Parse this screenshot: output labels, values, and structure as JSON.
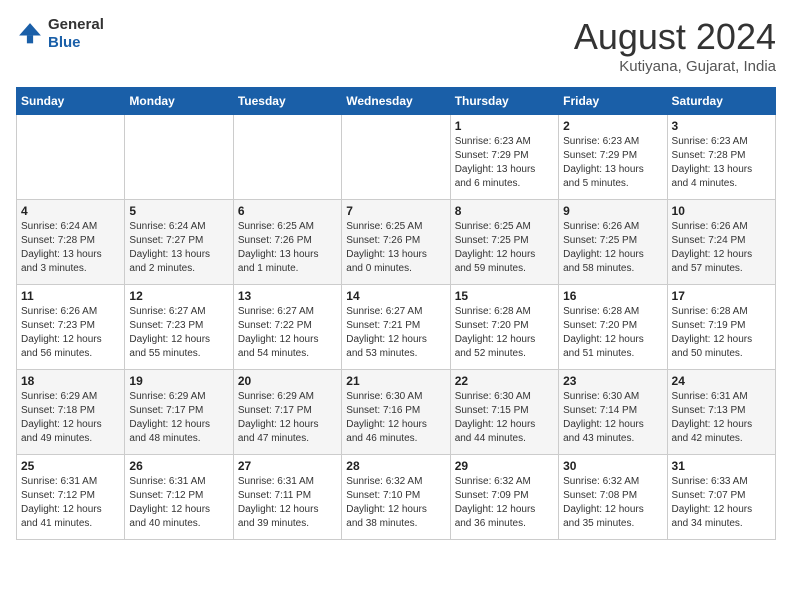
{
  "header": {
    "logo_line1": "General",
    "logo_line2": "Blue",
    "month_year": "August 2024",
    "location": "Kutiyana, Gujarat, India"
  },
  "weekdays": [
    "Sunday",
    "Monday",
    "Tuesday",
    "Wednesday",
    "Thursday",
    "Friday",
    "Saturday"
  ],
  "weeks": [
    [
      {
        "day": "",
        "info": ""
      },
      {
        "day": "",
        "info": ""
      },
      {
        "day": "",
        "info": ""
      },
      {
        "day": "",
        "info": ""
      },
      {
        "day": "1",
        "info": "Sunrise: 6:23 AM\nSunset: 7:29 PM\nDaylight: 13 hours and 6 minutes."
      },
      {
        "day": "2",
        "info": "Sunrise: 6:23 AM\nSunset: 7:29 PM\nDaylight: 13 hours and 5 minutes."
      },
      {
        "day": "3",
        "info": "Sunrise: 6:23 AM\nSunset: 7:28 PM\nDaylight: 13 hours and 4 minutes."
      }
    ],
    [
      {
        "day": "4",
        "info": "Sunrise: 6:24 AM\nSunset: 7:28 PM\nDaylight: 13 hours and 3 minutes."
      },
      {
        "day": "5",
        "info": "Sunrise: 6:24 AM\nSunset: 7:27 PM\nDaylight: 13 hours and 2 minutes."
      },
      {
        "day": "6",
        "info": "Sunrise: 6:25 AM\nSunset: 7:26 PM\nDaylight: 13 hours and 1 minute."
      },
      {
        "day": "7",
        "info": "Sunrise: 6:25 AM\nSunset: 7:26 PM\nDaylight: 13 hours and 0 minutes."
      },
      {
        "day": "8",
        "info": "Sunrise: 6:25 AM\nSunset: 7:25 PM\nDaylight: 12 hours and 59 minutes."
      },
      {
        "day": "9",
        "info": "Sunrise: 6:26 AM\nSunset: 7:25 PM\nDaylight: 12 hours and 58 minutes."
      },
      {
        "day": "10",
        "info": "Sunrise: 6:26 AM\nSunset: 7:24 PM\nDaylight: 12 hours and 57 minutes."
      }
    ],
    [
      {
        "day": "11",
        "info": "Sunrise: 6:26 AM\nSunset: 7:23 PM\nDaylight: 12 hours and 56 minutes."
      },
      {
        "day": "12",
        "info": "Sunrise: 6:27 AM\nSunset: 7:23 PM\nDaylight: 12 hours and 55 minutes."
      },
      {
        "day": "13",
        "info": "Sunrise: 6:27 AM\nSunset: 7:22 PM\nDaylight: 12 hours and 54 minutes."
      },
      {
        "day": "14",
        "info": "Sunrise: 6:27 AM\nSunset: 7:21 PM\nDaylight: 12 hours and 53 minutes."
      },
      {
        "day": "15",
        "info": "Sunrise: 6:28 AM\nSunset: 7:20 PM\nDaylight: 12 hours and 52 minutes."
      },
      {
        "day": "16",
        "info": "Sunrise: 6:28 AM\nSunset: 7:20 PM\nDaylight: 12 hours and 51 minutes."
      },
      {
        "day": "17",
        "info": "Sunrise: 6:28 AM\nSunset: 7:19 PM\nDaylight: 12 hours and 50 minutes."
      }
    ],
    [
      {
        "day": "18",
        "info": "Sunrise: 6:29 AM\nSunset: 7:18 PM\nDaylight: 12 hours and 49 minutes."
      },
      {
        "day": "19",
        "info": "Sunrise: 6:29 AM\nSunset: 7:17 PM\nDaylight: 12 hours and 48 minutes."
      },
      {
        "day": "20",
        "info": "Sunrise: 6:29 AM\nSunset: 7:17 PM\nDaylight: 12 hours and 47 minutes."
      },
      {
        "day": "21",
        "info": "Sunrise: 6:30 AM\nSunset: 7:16 PM\nDaylight: 12 hours and 46 minutes."
      },
      {
        "day": "22",
        "info": "Sunrise: 6:30 AM\nSunset: 7:15 PM\nDaylight: 12 hours and 44 minutes."
      },
      {
        "day": "23",
        "info": "Sunrise: 6:30 AM\nSunset: 7:14 PM\nDaylight: 12 hours and 43 minutes."
      },
      {
        "day": "24",
        "info": "Sunrise: 6:31 AM\nSunset: 7:13 PM\nDaylight: 12 hours and 42 minutes."
      }
    ],
    [
      {
        "day": "25",
        "info": "Sunrise: 6:31 AM\nSunset: 7:12 PM\nDaylight: 12 hours and 41 minutes."
      },
      {
        "day": "26",
        "info": "Sunrise: 6:31 AM\nSunset: 7:12 PM\nDaylight: 12 hours and 40 minutes."
      },
      {
        "day": "27",
        "info": "Sunrise: 6:31 AM\nSunset: 7:11 PM\nDaylight: 12 hours and 39 minutes."
      },
      {
        "day": "28",
        "info": "Sunrise: 6:32 AM\nSunset: 7:10 PM\nDaylight: 12 hours and 38 minutes."
      },
      {
        "day": "29",
        "info": "Sunrise: 6:32 AM\nSunset: 7:09 PM\nDaylight: 12 hours and 36 minutes."
      },
      {
        "day": "30",
        "info": "Sunrise: 6:32 AM\nSunset: 7:08 PM\nDaylight: 12 hours and 35 minutes."
      },
      {
        "day": "31",
        "info": "Sunrise: 6:33 AM\nSunset: 7:07 PM\nDaylight: 12 hours and 34 minutes."
      }
    ]
  ]
}
